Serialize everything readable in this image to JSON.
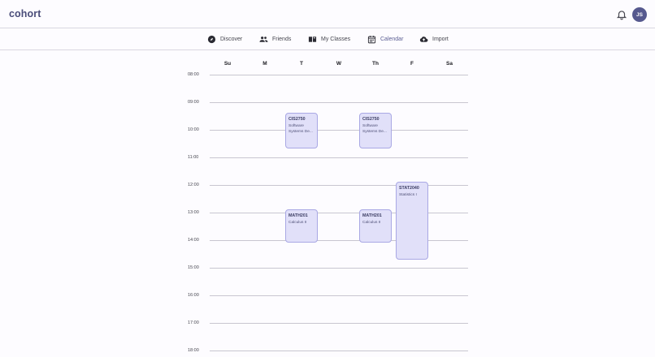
{
  "app": {
    "logo": "cohort",
    "avatar_initials": "JS"
  },
  "header": {
    "notification_icon": "bell-icon"
  },
  "nav": [
    {
      "label": "Discover",
      "icon": "compass-icon",
      "active": false
    },
    {
      "label": "Friends",
      "icon": "people-icon",
      "active": false
    },
    {
      "label": "My Classes",
      "icon": "book-icon",
      "active": false
    },
    {
      "label": "Calendar",
      "icon": "calendar-icon",
      "active": true
    },
    {
      "label": "Import",
      "icon": "cloud-upload-icon",
      "active": false
    }
  ],
  "calendar": {
    "days": [
      "Su",
      "M",
      "T",
      "W",
      "Th",
      "F",
      "Sa"
    ],
    "hours": [
      "08:00",
      "09:00",
      "10:00",
      "11:00",
      "12:00",
      "13:00",
      "14:00",
      "15:00",
      "16:00",
      "17:00",
      "18:00"
    ],
    "events": [
      {
        "code": "CIS2750",
        "title": "Software Systems De...",
        "day": "T",
        "start": "09:40",
        "end": "11:00"
      },
      {
        "code": "CIS2750",
        "title": "Software Systems De...",
        "day": "Th",
        "start": "09:40",
        "end": "11:00"
      },
      {
        "code": "MATH201",
        "title": "Calculus II",
        "day": "T",
        "start": "13:00",
        "end": "14:10"
      },
      {
        "code": "MATH201",
        "title": "Calculus II",
        "day": "Th",
        "start": "13:00",
        "end": "14:10"
      },
      {
        "code": "STAT2040",
        "title": "Statistics I",
        "day": "F",
        "start": "11:55",
        "end": "14:45"
      }
    ]
  },
  "colors": {
    "accent": "#5b5e93",
    "event_bg": "#e1e0f9",
    "event_border": "#a9a8e4"
  }
}
